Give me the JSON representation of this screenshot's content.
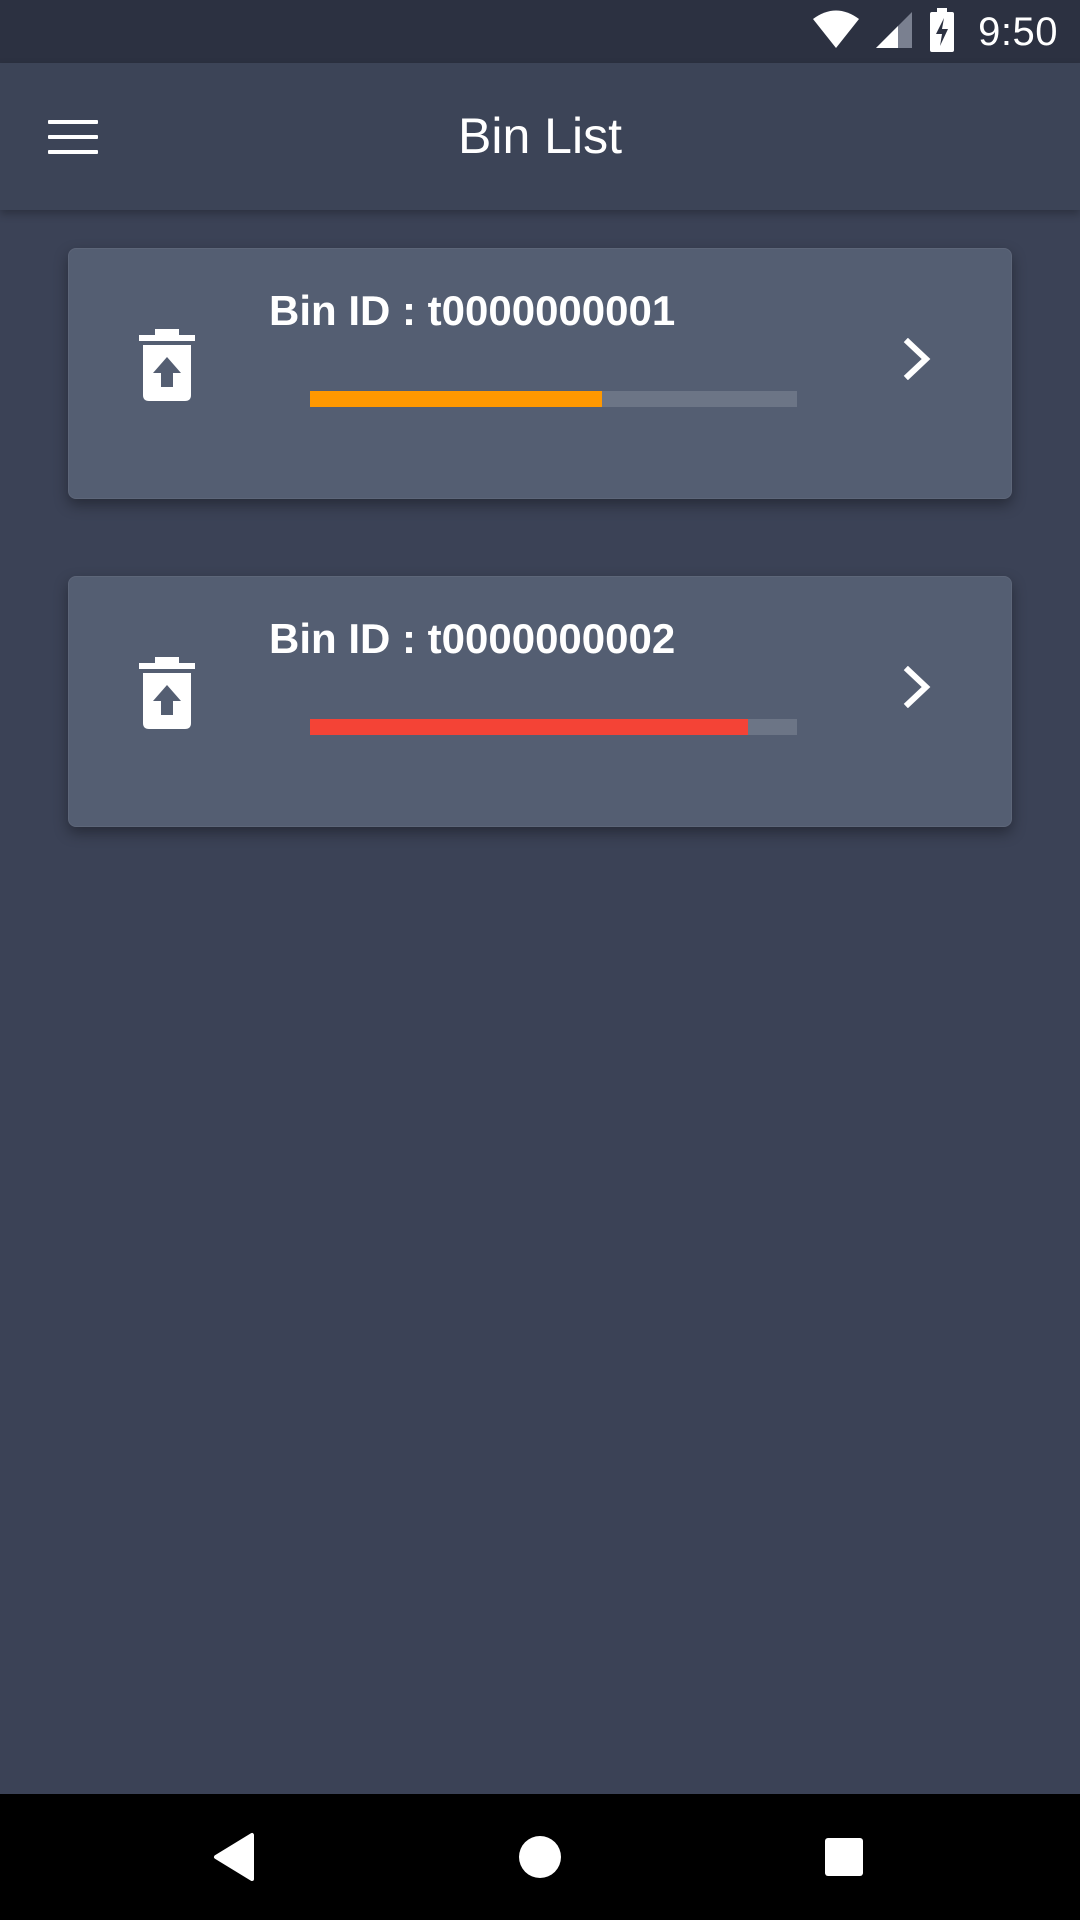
{
  "status_bar": {
    "time": "9:50",
    "icons": [
      "wifi-icon",
      "cell-signal-icon",
      "battery-charging-icon"
    ]
  },
  "app_bar": {
    "title": "Bin List",
    "menu_icon": "menu-icon"
  },
  "bins": [
    {
      "label": "Bin ID : t0000000001",
      "fill_level": 0.6,
      "fill_color": "#ff9800",
      "icon": "trash-restore-icon",
      "action_icon": "chevron-right-icon"
    },
    {
      "label": "Bin ID : t0000000002",
      "fill_level": 0.9,
      "fill_color": "#f44336",
      "icon": "trash-restore-icon",
      "action_icon": "chevron-right-icon"
    }
  ],
  "nav_bar": {
    "icons": [
      "back-icon",
      "home-icon",
      "recents-icon"
    ]
  },
  "colors": {
    "background": "#3b4256",
    "status_bar": "#2c3141",
    "app_bar": "#3c4457",
    "card": "#545e72",
    "track": "#6c7586"
  }
}
